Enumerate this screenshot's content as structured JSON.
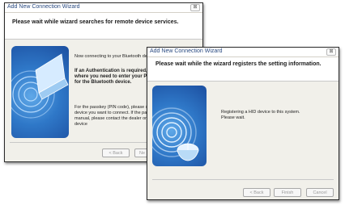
{
  "back_window": {
    "title": "Add New Connection Wizard",
    "close_glyph": "⊠",
    "header_text": "Please wait while wizard searches for remote device services.",
    "line_connecting": "Now connecting to your Bluetooth device",
    "auth_line1": "If an Authentication is required, a",
    "auth_line2": "where you need to enter your Pa",
    "auth_line3": "for the Bluetooth device.",
    "passkey_line1": "For the passkey (PIN code), please see",
    "passkey_line2": "device you want to connect. If the passk",
    "passkey_line3": "manual, please contact the dealer or th",
    "passkey_line4": "device",
    "back_button": "< Back",
    "next_button": "Ne"
  },
  "front_window": {
    "title": "Add New Connection Wizard",
    "close_glyph": "⊠",
    "header_text": "Please wait while the wizard registers the setting information.",
    "status_line1": "Registering a HID device to this system.",
    "status_line2": "Please wait.",
    "back_button": "< Back",
    "finish_button": "Finish",
    "cancel_button": "Cancel"
  },
  "colors": {
    "title_text": "#2a4a80",
    "panel_blue": "#2f78c8",
    "disabled_text": "#9a9a9a"
  }
}
